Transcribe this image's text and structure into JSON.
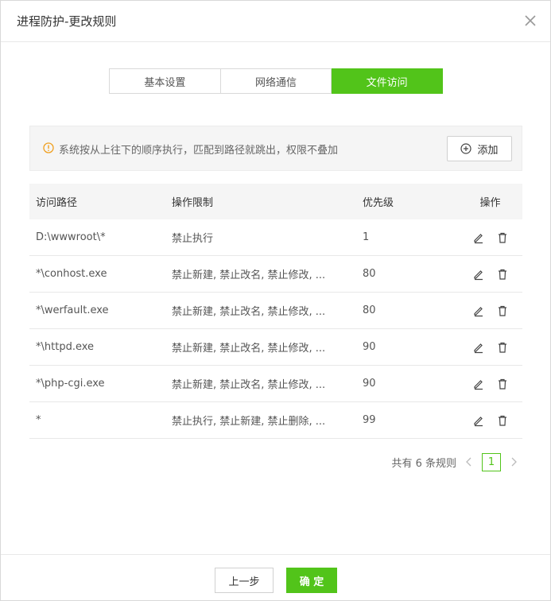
{
  "dialog": {
    "title": "进程防护-更改规则"
  },
  "tabs": [
    {
      "label": "基本设置",
      "active": false
    },
    {
      "label": "网络通信",
      "active": false
    },
    {
      "label": "文件访问",
      "active": true
    }
  ],
  "notice": {
    "text": "系统按从上往下的顺序执行，匹配到路径就跳出，权限不叠加",
    "add_label": "添加"
  },
  "table": {
    "headers": {
      "path": "访问路径",
      "ops": "操作限制",
      "priority": "优先级",
      "actions": "操作"
    },
    "rows": [
      {
        "path": "D:\\wwwroot\\*",
        "ops": "禁止执行",
        "priority": "1"
      },
      {
        "path": "*\\conhost.exe",
        "ops": "禁止新建, 禁止改名, 禁止修改, ...",
        "priority": "80"
      },
      {
        "path": "*\\werfault.exe",
        "ops": "禁止新建, 禁止改名, 禁止修改, ...",
        "priority": "80"
      },
      {
        "path": "*\\httpd.exe",
        "ops": "禁止新建, 禁止改名, 禁止修改, ...",
        "priority": "90"
      },
      {
        "path": "*\\php-cgi.exe",
        "ops": "禁止新建, 禁止改名, 禁止修改, ...",
        "priority": "90"
      },
      {
        "path": "*",
        "ops": "禁止执行, 禁止新建, 禁止删除, ...",
        "priority": "99"
      }
    ]
  },
  "pager": {
    "summary": "共有 6 条规则",
    "current": "1"
  },
  "footer": {
    "prev_label": "上一步",
    "ok_label": "确 定"
  },
  "colors": {
    "accent": "#52c41a",
    "warning": "#f0a020"
  },
  "icons": [
    "close-icon",
    "warning-circle-icon",
    "plus-circle-icon",
    "edit-icon",
    "delete-icon",
    "chevron-left-icon",
    "chevron-right-icon"
  ]
}
